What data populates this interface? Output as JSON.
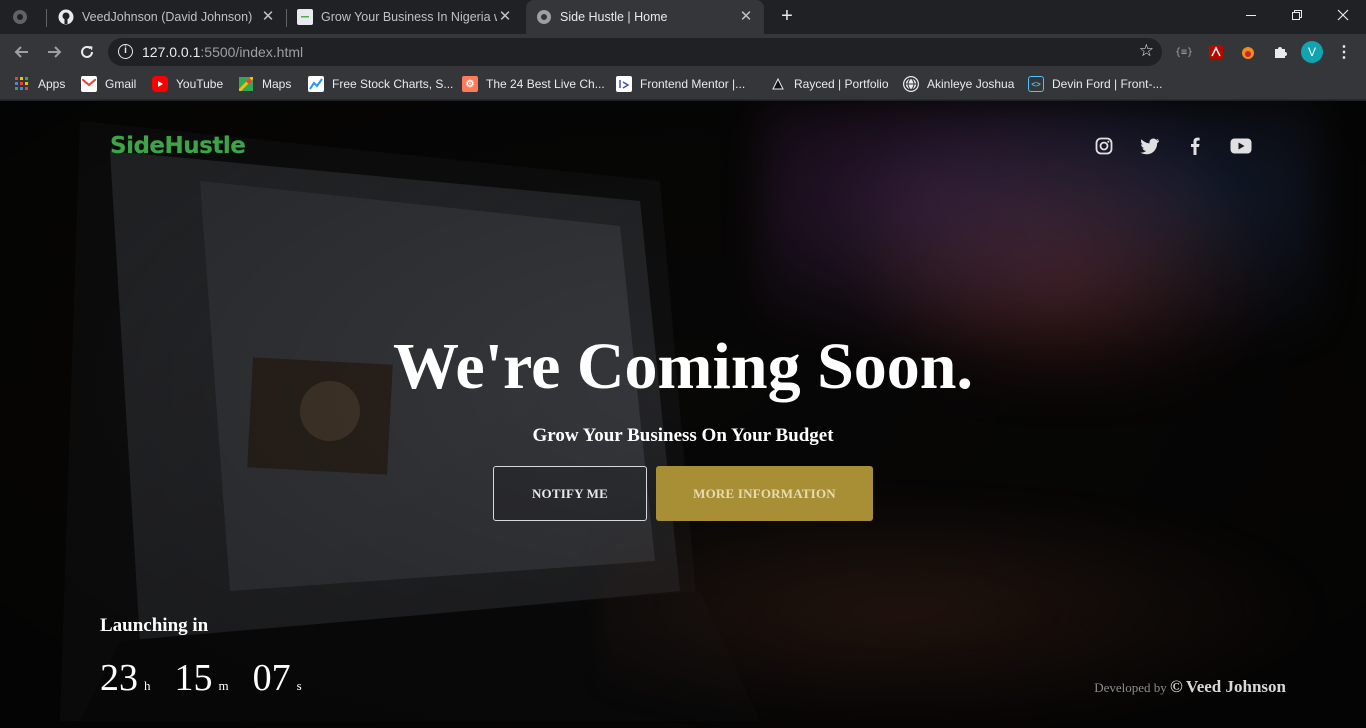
{
  "browser": {
    "tabs": [
      {
        "title": "VeedJohnson (David Johnson)",
        "icon": "github-icon",
        "active": false
      },
      {
        "title": "Grow Your Business In Nigeria wi",
        "icon": "page-icon",
        "active": false
      },
      {
        "title": "Side Hustle | Home",
        "icon": "globe-icon",
        "active": true
      }
    ],
    "url_host": "127.0.0.1",
    "url_rest": ":5500/index.html",
    "profile_initial": "V",
    "bookmarks": [
      {
        "label": "Apps",
        "icon": "apps-grid-icon"
      },
      {
        "label": "Gmail",
        "icon": "gmail-icon"
      },
      {
        "label": "YouTube",
        "icon": "youtube-icon"
      },
      {
        "label": "Maps",
        "icon": "maps-icon"
      },
      {
        "label": "Free Stock Charts, S...",
        "icon": "stock-charts-icon"
      },
      {
        "label": "The 24 Best Live Ch...",
        "icon": "hubspot-icon"
      },
      {
        "label": "Frontend Mentor |...",
        "icon": "frontend-mentor-icon"
      },
      {
        "label": "Rayced | Portfolio",
        "icon": "portfolio-icon"
      },
      {
        "label": "Akinleye Joshua",
        "icon": "globe-icon"
      },
      {
        "label": "Devin Ford | Front-...",
        "icon": "code-icon"
      }
    ]
  },
  "page": {
    "logo_text": "SideHustle",
    "social": [
      "instagram-icon",
      "twitter-icon",
      "facebook-icon",
      "youtube-icon"
    ],
    "headline": "We're Coming Soon.",
    "subheadline": "Grow Your Business On Your Budget",
    "notify_label": "NOTIFY ME",
    "more_label": "MORE INFORMATION",
    "launching_label": "Launching in",
    "countdown": {
      "hours": "23",
      "hours_unit": "h",
      "minutes": "15",
      "minutes_unit": "m",
      "seconds": "07",
      "seconds_unit": "s"
    },
    "developed_by_label": "Developed by",
    "copyright": "©",
    "developer_name": "Veed Johnson"
  },
  "colors": {
    "logo": "#3fa34a",
    "accent_button": "#a88f35"
  }
}
